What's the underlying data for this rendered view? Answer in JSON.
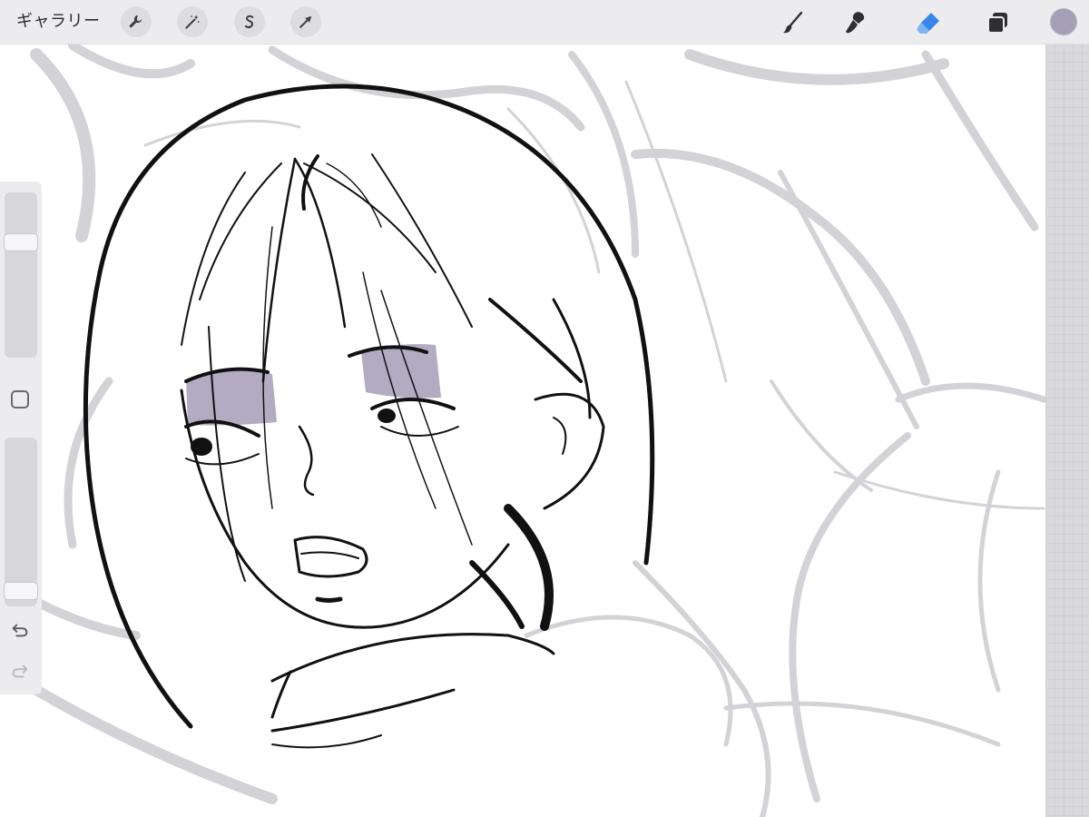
{
  "toolbar": {
    "gallery_label": "ギャラリー",
    "left_tools": [
      {
        "name": "actions",
        "icon": "wrench-icon"
      },
      {
        "name": "adjustments",
        "icon": "magic-wand-icon"
      },
      {
        "name": "selection",
        "icon": "selection-s-icon"
      },
      {
        "name": "transform",
        "icon": "cursor-arrow-icon"
      }
    ],
    "right_tools": [
      {
        "name": "brush",
        "icon": "brush-icon"
      },
      {
        "name": "smudge",
        "icon": "smudge-icon"
      },
      {
        "name": "eraser",
        "icon": "eraser-icon",
        "active": true
      },
      {
        "name": "layers",
        "icon": "layers-icon"
      }
    ],
    "current_color": "#a59fb5"
  },
  "sidebar": {
    "brush_size_level": 0.72,
    "opacity_level": 0.05,
    "modify_icon": "square-icon",
    "undo_icon": "undo-icon",
    "redo_icon": "redo-icon"
  },
  "theme": {
    "toolbar_bg": "#ececef",
    "accent_blue": "#3a85e6",
    "sketch_gray": "#d3d3d7",
    "ink": "#111111",
    "eye_shadow": "#b2abc1"
  }
}
